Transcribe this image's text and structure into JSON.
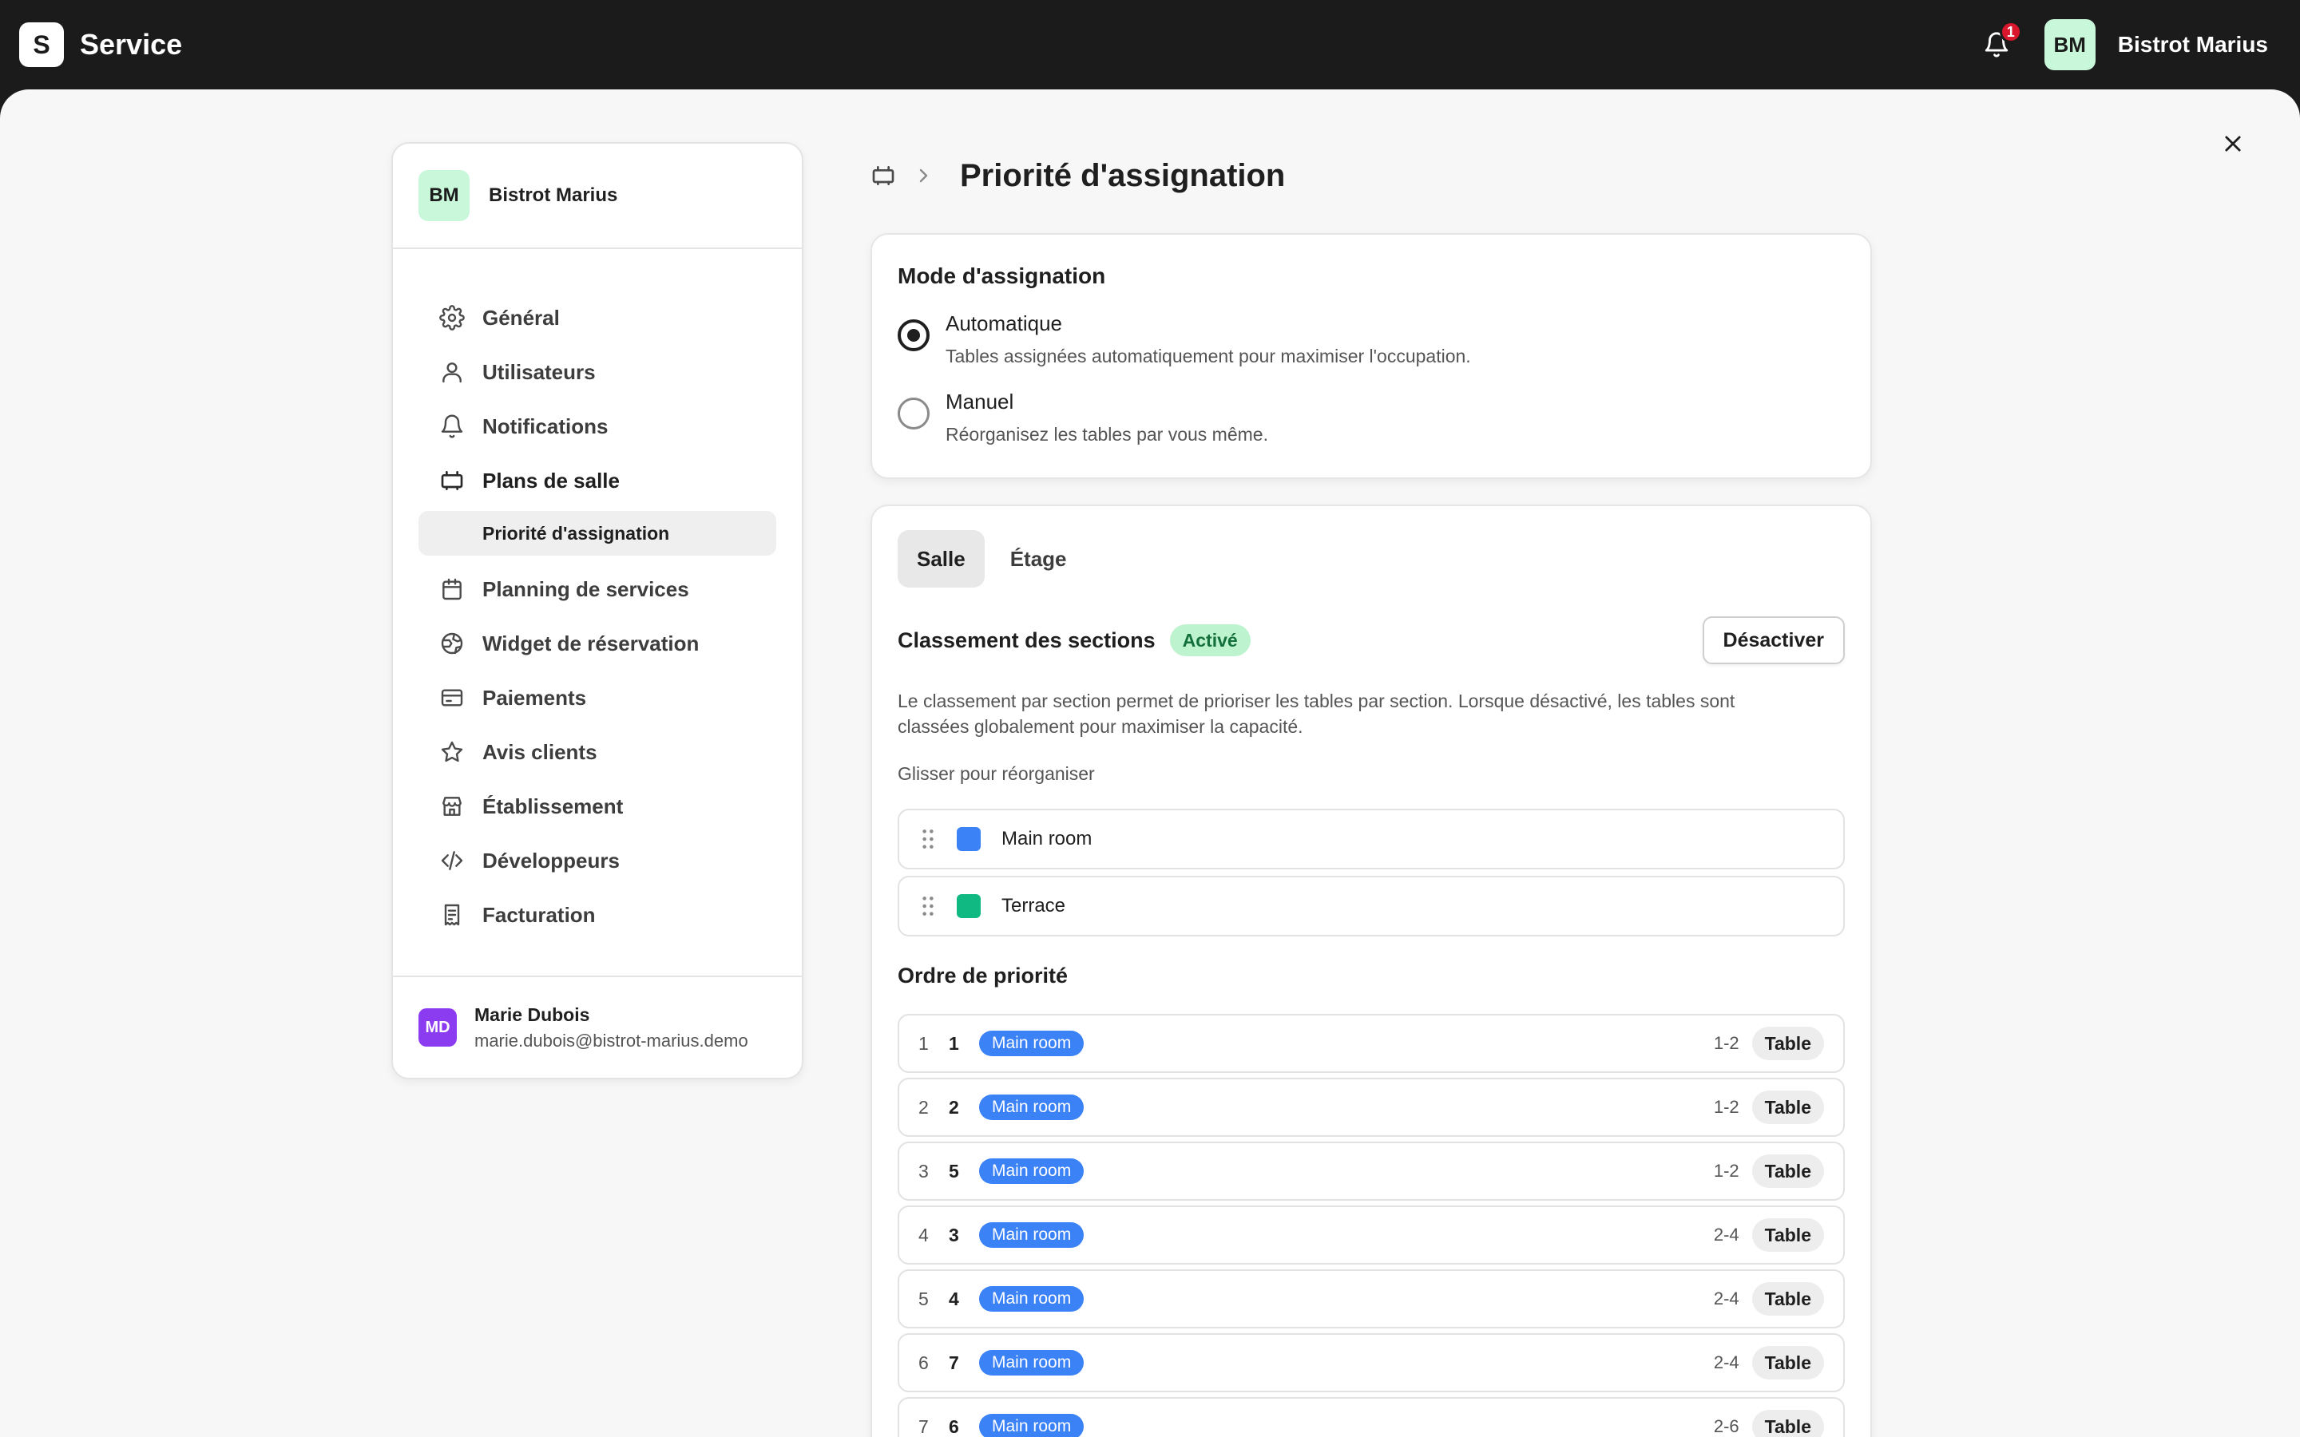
{
  "app": {
    "logo_letter": "S",
    "name": "Service",
    "notifications_count": "1",
    "account_initials": "BM",
    "account_name": "Bistrot Marius"
  },
  "sidebar": {
    "org_initials": "BM",
    "org_name": "Bistrot Marius",
    "items": [
      {
        "label": "Général",
        "icon": "gear-icon"
      },
      {
        "label": "Utilisateurs",
        "icon": "user-icon"
      },
      {
        "label": "Notifications",
        "icon": "bell-icon"
      },
      {
        "label": "Plans de salle",
        "icon": "floor-plan-icon"
      },
      {
        "label": "Planning de services",
        "icon": "calendar-icon"
      },
      {
        "label": "Widget de réservation",
        "icon": "globe-icon"
      },
      {
        "label": "Paiements",
        "icon": "credit-card-icon"
      },
      {
        "label": "Avis clients",
        "icon": "star-icon"
      },
      {
        "label": "Établissement",
        "icon": "store-icon"
      },
      {
        "label": "Développeurs",
        "icon": "code-icon"
      },
      {
        "label": "Facturation",
        "icon": "receipt-icon"
      }
    ],
    "sub_item": "Priorité d'assignation",
    "user": {
      "initials": "MD",
      "name": "Marie Dubois",
      "email": "marie.dubois@bistrot-marius.demo"
    }
  },
  "page": {
    "title": "Priorité d'assignation",
    "breadcrumb_icon": "floor-plan-icon"
  },
  "mode": {
    "title": "Mode d'assignation",
    "options": [
      {
        "label": "Automatique",
        "description": "Tables assignées automatiquement pour maximiser l'occupation.",
        "selected": true
      },
      {
        "label": "Manuel",
        "description": "Réorganisez les tables par vous même.",
        "selected": false
      }
    ]
  },
  "tabs": [
    {
      "label": "Salle",
      "active": true
    },
    {
      "label": "Étage",
      "active": false
    }
  ],
  "sections": {
    "title": "Classement des sections",
    "status_badge": "Activé",
    "toggle_button": "Désactiver",
    "description": "Le classement par section permet de prioriser les tables par section. Lorsque désactivé, les tables sont classées globalement pour maximiser la capacité.",
    "drag_hint": "Glisser pour réorganiser",
    "items": [
      {
        "label": "Main room",
        "color": "#3b82f6"
      },
      {
        "label": "Terrace",
        "color": "#10b981"
      }
    ]
  },
  "priority": {
    "title": "Ordre de priorité",
    "section_color": "#3b82f6",
    "rows": [
      {
        "index": "1",
        "table": "1",
        "section": "Main room",
        "capacity": "1-2",
        "type": "Table"
      },
      {
        "index": "2",
        "table": "2",
        "section": "Main room",
        "capacity": "1-2",
        "type": "Table"
      },
      {
        "index": "3",
        "table": "5",
        "section": "Main room",
        "capacity": "1-2",
        "type": "Table"
      },
      {
        "index": "4",
        "table": "3",
        "section": "Main room",
        "capacity": "2-4",
        "type": "Table"
      },
      {
        "index": "5",
        "table": "4",
        "section": "Main room",
        "capacity": "2-4",
        "type": "Table"
      },
      {
        "index": "6",
        "table": "7",
        "section": "Main room",
        "capacity": "2-4",
        "type": "Table"
      },
      {
        "index": "7",
        "table": "6",
        "section": "Main room",
        "capacity": "2-6",
        "type": "Table"
      }
    ]
  }
}
